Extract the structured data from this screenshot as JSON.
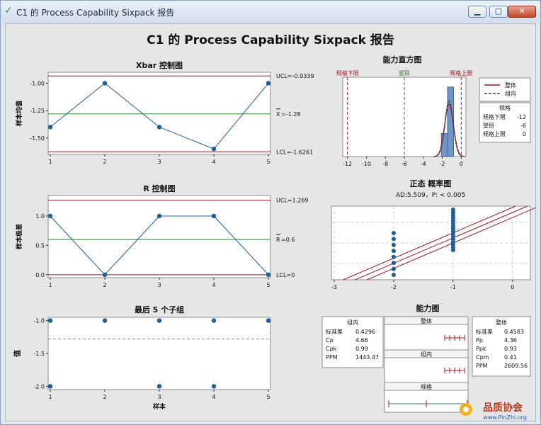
{
  "window": {
    "title": "C1 的 Process Capability Sixpack 报告"
  },
  "report_title": "C1 的 Process Capability Sixpack 报告",
  "watermark": {
    "brand": "品质协会",
    "url": "www.PinZhi.org"
  },
  "colors": {
    "data": "#1a5e9c",
    "limit": "#a3141f",
    "center": "#2e8b2e",
    "bar": "#6f95c8",
    "dash": "#777777",
    "target": "#2e7d32"
  },
  "chart_data": [
    {
      "id": "xbar",
      "type": "line",
      "title": "Xbar 控制图",
      "ylabel": "样本均值",
      "x": [
        1,
        2,
        3,
        4,
        5
      ],
      "y": [
        -1.4,
        -1.0,
        -1.4,
        -1.6,
        -1.0
      ],
      "ylim": [
        -1.65,
        -0.9
      ],
      "yticks": [
        -1.0,
        -1.25,
        -1.5
      ],
      "ytick_labels": [
        "-1.00",
        "-1.25",
        "-1.50"
      ],
      "xticks": [
        "1",
        "2",
        "3",
        "4",
        "5"
      ],
      "lines": {
        "ucl": -0.9339,
        "center": -1.28,
        "lcl": -1.6261
      },
      "labels": {
        "ucl": "UCL=-0.9339",
        "center_sym": "X",
        "center_val": "=-1.28",
        "lcl": "LCL=-1.6261"
      }
    },
    {
      "id": "hist",
      "type": "bar",
      "title": "能力直方图",
      "bins": [
        {
          "from": -2.1,
          "to": -1.45,
          "count": 1
        },
        {
          "from": -1.45,
          "to": -0.8,
          "count": 3
        }
      ],
      "xlim": [
        -12.5,
        0.5
      ],
      "ylim": [
        0,
        3.3
      ],
      "xticks": [
        -12,
        -10,
        -8,
        -6,
        -4,
        -2,
        0
      ],
      "spec": {
        "lsl": -12,
        "target": -6,
        "usl": 0
      },
      "spec_labels": {
        "lsl": "规格下限",
        "target": "望目",
        "usl": "规格上限"
      },
      "dist": {
        "mean": -1.28,
        "sd_overall": 0.4583,
        "sd_within": 0.4296
      }
    },
    {
      "id": "legend",
      "type": "table",
      "series": [
        {
          "name": "整体",
          "style": "solid"
        },
        {
          "name": "组内",
          "style": "dashed"
        }
      ],
      "spec_title": "规格",
      "spec_rows": [
        [
          "规格下限",
          "-12"
        ],
        [
          "望目",
          "-6"
        ],
        [
          "规格上限",
          "0"
        ]
      ]
    },
    {
      "id": "range",
      "type": "line",
      "title": "R 控制图",
      "ylabel": "样本极差",
      "x": [
        1,
        2,
        3,
        4,
        5
      ],
      "y": [
        1.0,
        0.0,
        1.0,
        1.0,
        0.0
      ],
      "ylim": [
        -0.05,
        1.35
      ],
      "yticks": [
        1.0,
        0.5,
        0.0
      ],
      "ytick_labels": [
        "1.0",
        "0.5",
        "0.0"
      ],
      "xticks": [
        "1",
        "2",
        "3",
        "4",
        "5"
      ],
      "lines": {
        "ucl": 1.269,
        "center": 0.6,
        "lcl": 0
      },
      "labels": {
        "ucl": "UCL=1.269",
        "center_sym": "R",
        "center_val": "=0.6",
        "lcl": "LCL=0"
      }
    },
    {
      "id": "prob",
      "type": "scatter",
      "title": "正态 概率图",
      "subtitle": "AD:5.509，P: < 0.005",
      "xlim": [
        -3,
        0.3
      ],
      "xticks": [
        -3,
        -2,
        -1,
        0
      ],
      "points": [
        {
          "x": -2,
          "n": 8
        },
        {
          "x": -1,
          "n": 16
        }
      ]
    },
    {
      "id": "last5",
      "type": "scatter",
      "title": "最后 5 个子组",
      "ylabel": "值",
      "xlabel": "样本",
      "ylim": [
        -2.05,
        -0.95
      ],
      "yticks": [
        -1.0,
        -1.5,
        -2.0
      ],
      "ytick_labels": [
        "-1.0",
        "-1.5",
        "-2.0"
      ],
      "xticks": [
        "1",
        "2",
        "3",
        "4",
        "5"
      ],
      "mean_line": -1.28,
      "points": [
        [
          1,
          -1
        ],
        [
          1,
          -2
        ],
        [
          2,
          -1
        ],
        [
          3,
          -1
        ],
        [
          3,
          -2
        ],
        [
          4,
          -1
        ],
        [
          4,
          -2
        ],
        [
          5,
          -1
        ]
      ]
    },
    {
      "id": "capability",
      "type": "table",
      "title": "能力图",
      "within": {
        "title": "组内",
        "rows": [
          [
            "标准差",
            "0.4296"
          ],
          [
            "Cp",
            "4.66"
          ],
          [
            "Cpk",
            "0.99"
          ],
          [
            "PPM",
            "1443.47"
          ]
        ]
      },
      "overall": {
        "title": "整体",
        "rows": [
          [
            "标准差",
            "0.4583"
          ],
          [
            "Pp",
            "4.36"
          ],
          [
            "Ppk",
            "0.93"
          ],
          [
            "Cpm",
            "0.41"
          ],
          [
            "PPM",
            "2609.56"
          ]
        ]
      },
      "panels": [
        "整体",
        "组内",
        "规格"
      ]
    }
  ]
}
